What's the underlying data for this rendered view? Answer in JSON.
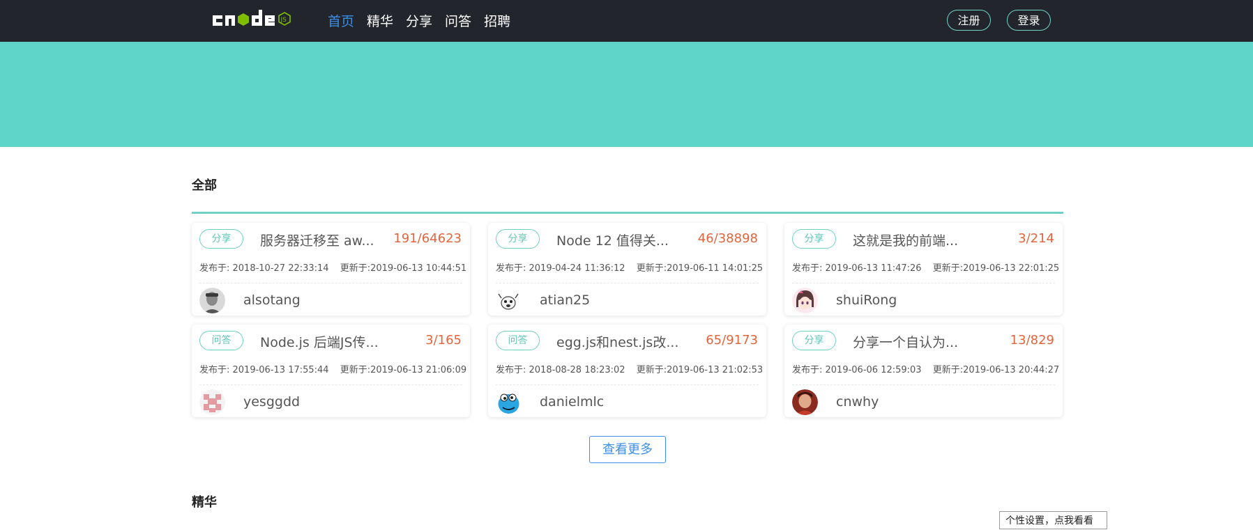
{
  "nav": {
    "items": [
      {
        "label": "首页",
        "active": true
      },
      {
        "label": "精华",
        "active": false
      },
      {
        "label": "分享",
        "active": false
      },
      {
        "label": "问答",
        "active": false
      },
      {
        "label": "招聘",
        "active": false
      }
    ],
    "register_label": "注册",
    "login_label": "登录"
  },
  "colors": {
    "topbar": "#23252c",
    "accent": "#5fd5c8",
    "link_active": "#3b8fe8",
    "count": "#e4643c"
  },
  "sections": {
    "all_title": "全部",
    "good_title": "精华"
  },
  "topics": [
    {
      "tag": "分享",
      "title": "服务器迁移至 aw...",
      "count": "191/64623",
      "created": "发布于: 2018-10-27 22:33:14",
      "updated": "更新于:2019-06-13 10:44:51",
      "author": "alsotang",
      "avatar_icon": "avatar-photo-icon"
    },
    {
      "tag": "分享",
      "title": "Node 12 值得关...",
      "count": "46/38898",
      "created": "发布于: 2019-04-24 11:36:12",
      "updated": "更新于:2019-06-11 14:01:25",
      "author": "atian25",
      "avatar_icon": "avatar-cartoon-icon"
    },
    {
      "tag": "分享",
      "title": "这就是我的前端...",
      "count": "3/214",
      "created": "发布于: 2019-06-13 11:47:26",
      "updated": "更新于:2019-06-13 22:01:25",
      "author": "shuiRong",
      "avatar_icon": "avatar-anime-icon"
    },
    {
      "tag": "问答",
      "title": "Node.js 后端JS传...",
      "count": "3/165",
      "created": "发布于: 2019-06-13 17:55:44",
      "updated": "更新于:2019-06-13 21:06:09",
      "author": "yesggdd",
      "avatar_icon": "avatar-identicon-icon"
    },
    {
      "tag": "问答",
      "title": "egg.js和nest.js改...",
      "count": "65/9173",
      "created": "发布于: 2018-08-28 18:23:02",
      "updated": "更新于:2019-06-13 21:02:53",
      "author": "danielmlc",
      "avatar_icon": "avatar-monster-icon"
    },
    {
      "tag": "分享",
      "title": "分享一个自认为...",
      "count": "13/829",
      "created": "发布于: 2019-06-06 12:59:03",
      "updated": "更新于:2019-06-13 20:44:27",
      "author": "cnwhy",
      "avatar_icon": "avatar-portrait-icon"
    }
  ],
  "more_label": "查看更多",
  "tooltip": "个性设置，点我看看"
}
